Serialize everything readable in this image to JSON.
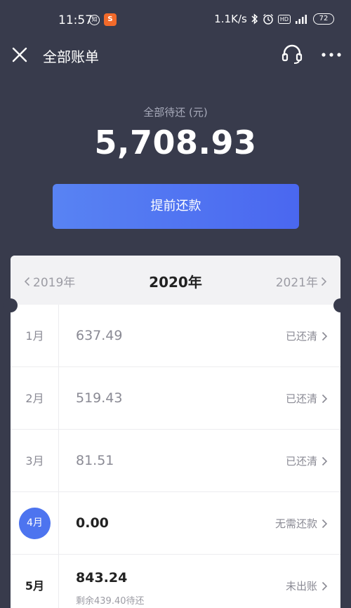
{
  "status_bar": {
    "time": "11:57",
    "notif1": "知",
    "notif2": "S",
    "net_speed": "1.1K/s",
    "hd": "HD",
    "battery": "72"
  },
  "header": {
    "title": "全部账单"
  },
  "summary": {
    "label": "全部待还 (元)",
    "amount": "5,708.93"
  },
  "prepay_button": "提前还款",
  "year_nav": {
    "prev": "2019年",
    "current": "2020年",
    "next": "2021年"
  },
  "bills": [
    {
      "month": "1月",
      "amount": "637.49",
      "status": "已还清"
    },
    {
      "month": "2月",
      "amount": "519.43",
      "status": "已还清"
    },
    {
      "month": "3月",
      "amount": "81.51",
      "status": "已还清"
    },
    {
      "month": "4月",
      "amount": "0.00",
      "status": "无需还款"
    },
    {
      "month": "5月",
      "amount": "843.24",
      "status": "未出账",
      "sub": "剩余439.40待还"
    }
  ],
  "colors": {
    "background": "#383b4c",
    "accent": "#4d74ef"
  }
}
